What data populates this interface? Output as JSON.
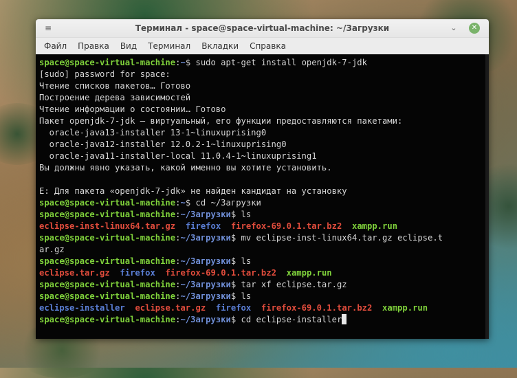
{
  "window": {
    "title": "Терминал - space@space-virtual-machine: ~/Загрузки",
    "min_symbol": "⌄",
    "close_symbol": "✕",
    "menu_symbol": "≡"
  },
  "menu": {
    "items": [
      "Файл",
      "Правка",
      "Вид",
      "Терминал",
      "Вкладки",
      "Справка"
    ]
  },
  "terminal": {
    "user": "space@space-virtual-machine",
    "lines": [
      {
        "type": "prompt",
        "path": "~",
        "cmd": "sudo apt-get install openjdk-7-jdk"
      },
      {
        "type": "text",
        "text": "[sudo] password for space:"
      },
      {
        "type": "text",
        "text": "Чтение списков пакетов… Готово"
      },
      {
        "type": "text",
        "text": "Построение дерева зависимостей"
      },
      {
        "type": "text",
        "text": "Чтение информации о состоянии… Готово"
      },
      {
        "type": "text",
        "text": "Пакет openjdk-7-jdk — виртуальный, его функции предоставляются пакетами:"
      },
      {
        "type": "text",
        "text": "  oracle-java13-installer 13-1~linuxuprising0"
      },
      {
        "type": "text",
        "text": "  oracle-java12-installer 12.0.2-1~linuxuprising0"
      },
      {
        "type": "text",
        "text": "  oracle-java11-installer-local 11.0.4-1~linuxuprising1"
      },
      {
        "type": "text",
        "text": "Вы должны явно указать, какой именно вы хотите установить."
      },
      {
        "type": "text",
        "text": ""
      },
      {
        "type": "text",
        "text": "E: Для пакета «openjdk-7-jdk» не найден кандидат на установку"
      },
      {
        "type": "prompt",
        "path": "~",
        "cmd": "cd ~/Загрузки"
      },
      {
        "type": "prompt",
        "path": "~/Загрузки",
        "cmd": "ls"
      },
      {
        "type": "ls",
        "items": [
          {
            "name": "eclipse-inst-linux64.tar.gz",
            "kind": "archive"
          },
          {
            "name": "firefox",
            "kind": "dir"
          },
          {
            "name": "firefox-69.0.1.tar.bz2",
            "kind": "archive"
          },
          {
            "name": "xampp.run",
            "kind": "exec"
          }
        ]
      },
      {
        "type": "prompt",
        "path": "~/Загрузки",
        "cmd": "mv eclipse-inst-linux64.tar.gz eclipse.t"
      },
      {
        "type": "text",
        "text": "ar.gz"
      },
      {
        "type": "prompt",
        "path": "~/Загрузки",
        "cmd": "ls"
      },
      {
        "type": "ls",
        "items": [
          {
            "name": "eclipse.tar.gz",
            "kind": "archive"
          },
          {
            "name": "firefox",
            "kind": "dir"
          },
          {
            "name": "firefox-69.0.1.tar.bz2",
            "kind": "archive"
          },
          {
            "name": "xampp.run",
            "kind": "exec"
          }
        ]
      },
      {
        "type": "prompt",
        "path": "~/Загрузки",
        "cmd": "tar xf eclipse.tar.gz"
      },
      {
        "type": "prompt",
        "path": "~/Загрузки",
        "cmd": "ls"
      },
      {
        "type": "ls",
        "items": [
          {
            "name": "eclipse-installer",
            "kind": "dir"
          },
          {
            "name": "eclipse.tar.gz",
            "kind": "archive"
          },
          {
            "name": "firefox",
            "kind": "dir"
          },
          {
            "name": "firefox-69.0.1.tar.bz2",
            "kind": "archive"
          },
          {
            "name": "xampp.run",
            "kind": "exec"
          }
        ]
      },
      {
        "type": "prompt",
        "path": "~/Загрузки",
        "cmd": "cd eclipse-installer",
        "cursor": true
      }
    ]
  },
  "colors": {
    "prompt_user": "#7fd13b",
    "prompt_path": "#6f8ed6",
    "archive": "#e04c3c",
    "dir": "#5b7fd6",
    "exec": "#7fd13b",
    "terminal_bg": "#050505"
  }
}
